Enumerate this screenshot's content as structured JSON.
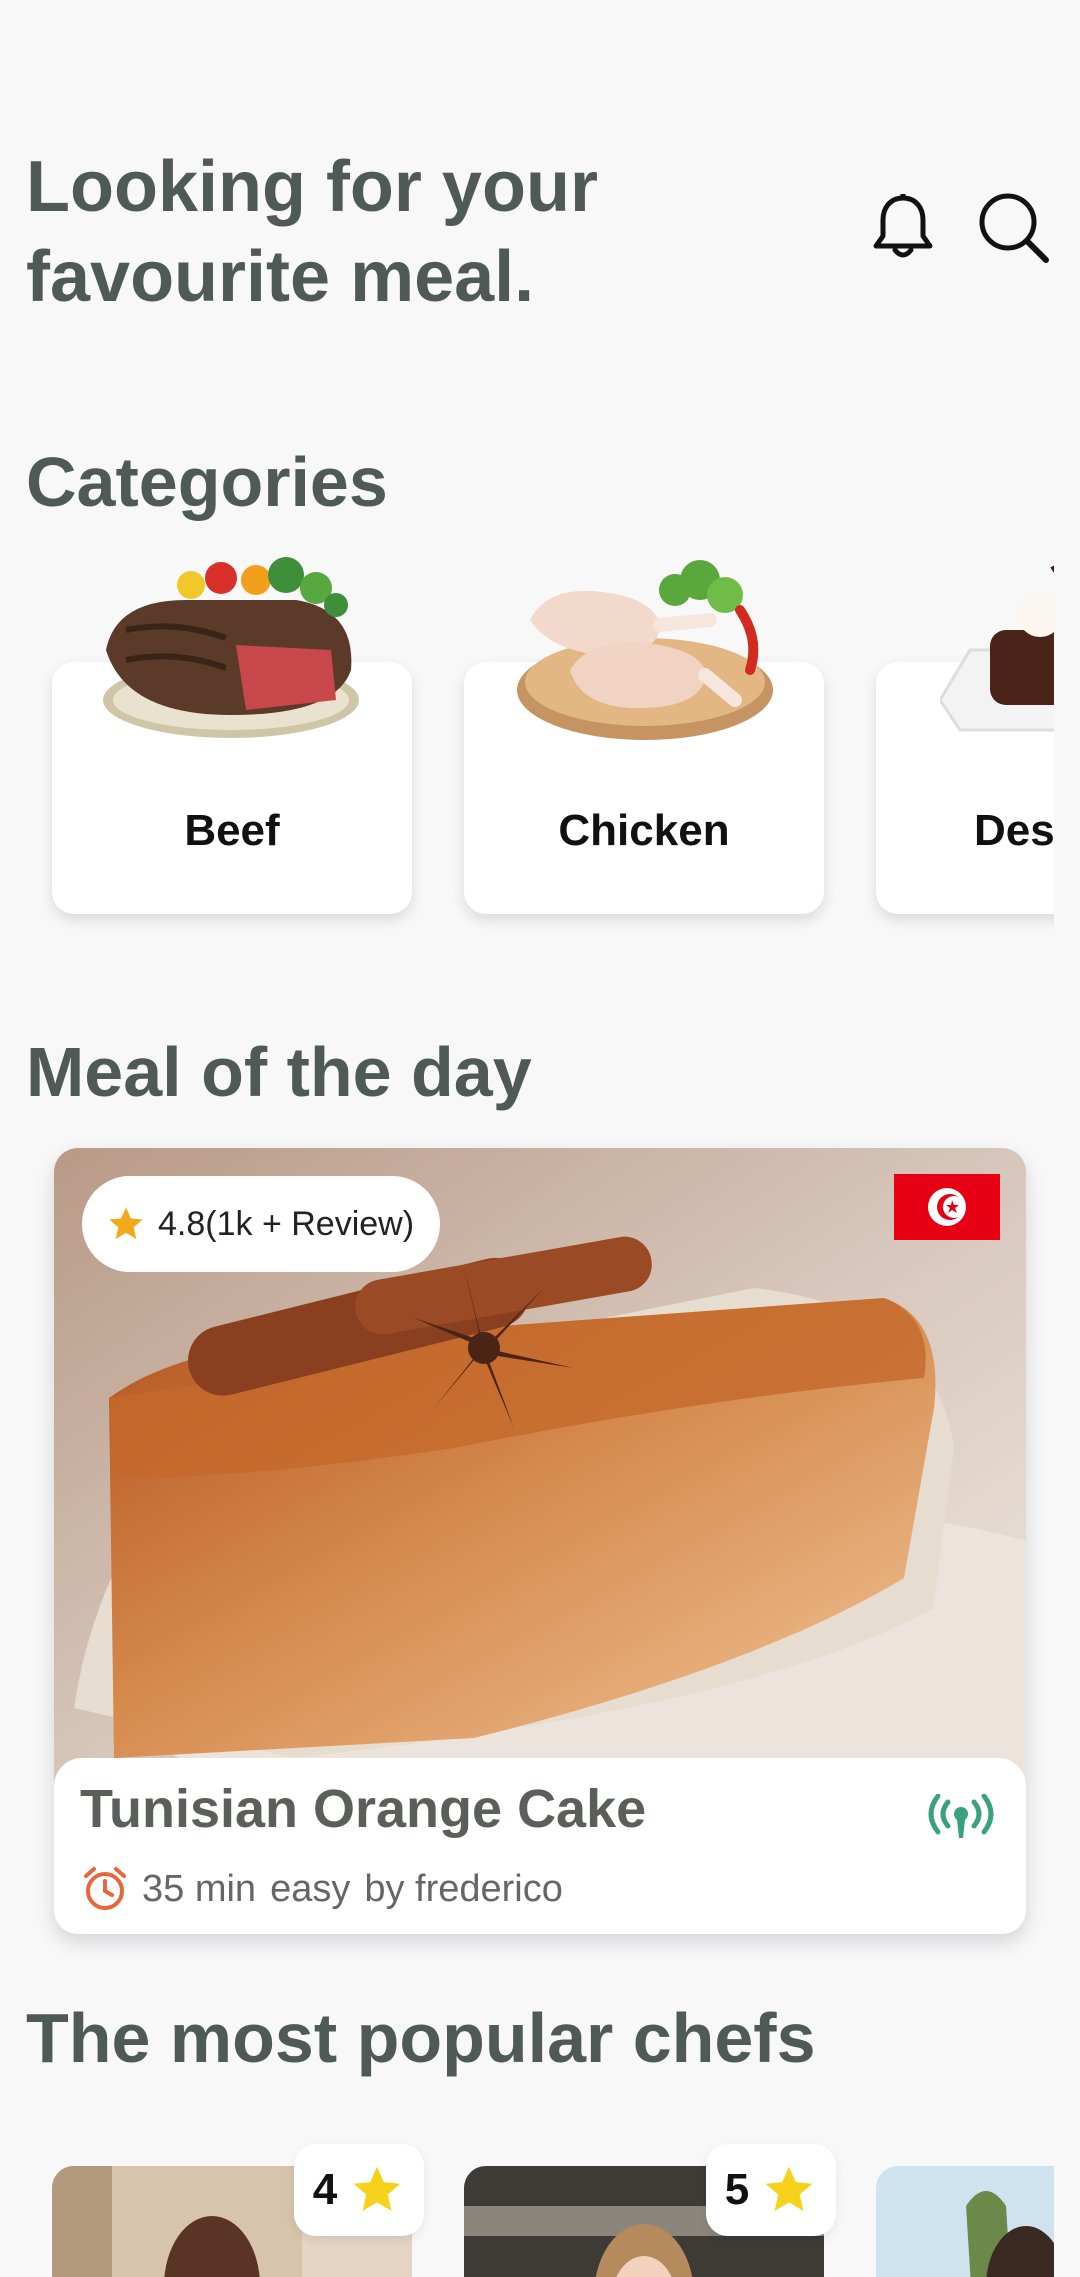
{
  "header": {
    "title_line1": "Looking for your",
    "title_line2": "favourite meal.",
    "icons": [
      "bell-icon",
      "search-icon"
    ]
  },
  "categories": {
    "title": "Categories",
    "items": [
      {
        "label": "Beef",
        "image": "beef-steak"
      },
      {
        "label": "Chicken",
        "image": "chicken-legs"
      },
      {
        "label": "Dessert",
        "image": "chocolate-dessert"
      }
    ]
  },
  "meal_of_day": {
    "title": "Meal of the day",
    "rating": "4.8(1k + Review)",
    "name": "Tunisian Orange Cake",
    "time": "35 min",
    "difficulty": "easy",
    "author": "by frederico",
    "flag": "tunisia-flag",
    "colors": {
      "star": "#f2a91c",
      "alarm": "#e8663d",
      "live": "#3aa27a"
    }
  },
  "chefs": {
    "title": "The most popular chefs",
    "items": [
      {
        "rating": "4"
      },
      {
        "rating": "5"
      },
      {
        "rating": ""
      }
    ]
  }
}
